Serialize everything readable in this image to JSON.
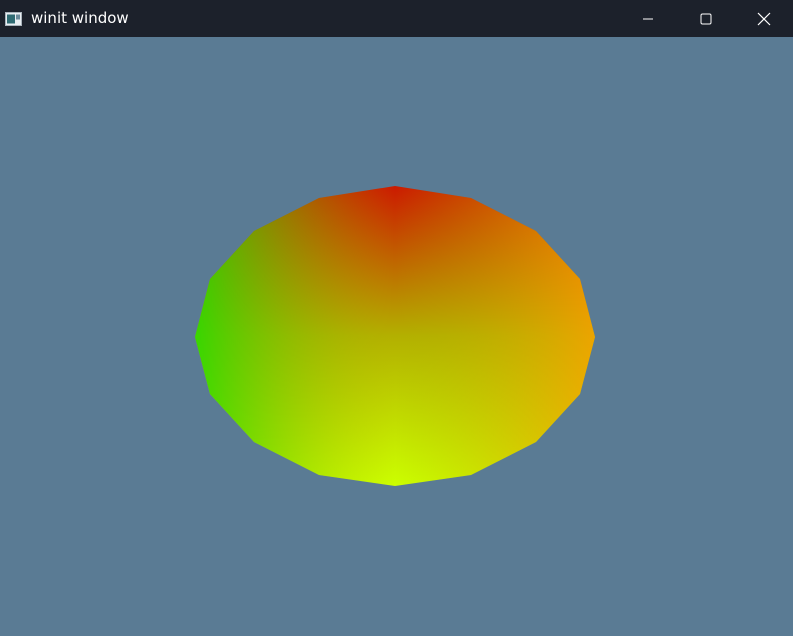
{
  "window": {
    "title": "winit window",
    "background_color": "#5a7b94",
    "titlebar_color": "#1c212b"
  },
  "titlebar": {
    "app_icon": "app-window-icon",
    "controls": [
      "minimize-icon",
      "maximize-icon",
      "close-icon"
    ]
  },
  "scene": {
    "shape": "shaded polygon (sphere-like)",
    "colors": {
      "top": "#cc1a00",
      "left": "#33dd00",
      "right": "#f5a800",
      "bottom": "#ccff00",
      "center": "#b0b400"
    }
  }
}
